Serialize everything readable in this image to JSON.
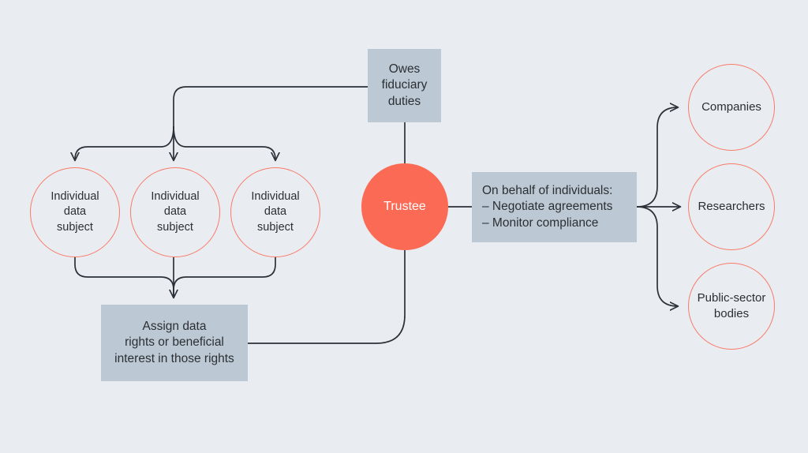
{
  "diagram": {
    "title": "Data trustee relationship diagram",
    "background_color": "#e9edf1",
    "colors": {
      "box_fill": "#bcc8d3",
      "circle_outline": "#fa7a68",
      "trustee_fill": "#fb6a54",
      "connector": "#2b3138",
      "text": "#2b2f33",
      "trustee_text": "#ffffff"
    },
    "nodes": {
      "owes_fiduciary_duties": "Owes\nfiduciary\nduties",
      "trustee": "Trustee",
      "on_behalf": "On behalf of individuals:\n– Negotiate agreements\n– Monitor compliance",
      "assign_rights": "Assign data\nrights or beneficial\ninterest in those rights",
      "individual_1": "Individual\ndata\nsubject",
      "individual_2": "Individual\ndata\nsubject",
      "individual_3": "Individual\ndata\nsubject",
      "companies": "Companies",
      "researchers": "Researchers",
      "public_sector_bodies": "Public-sector\nbodies"
    }
  }
}
